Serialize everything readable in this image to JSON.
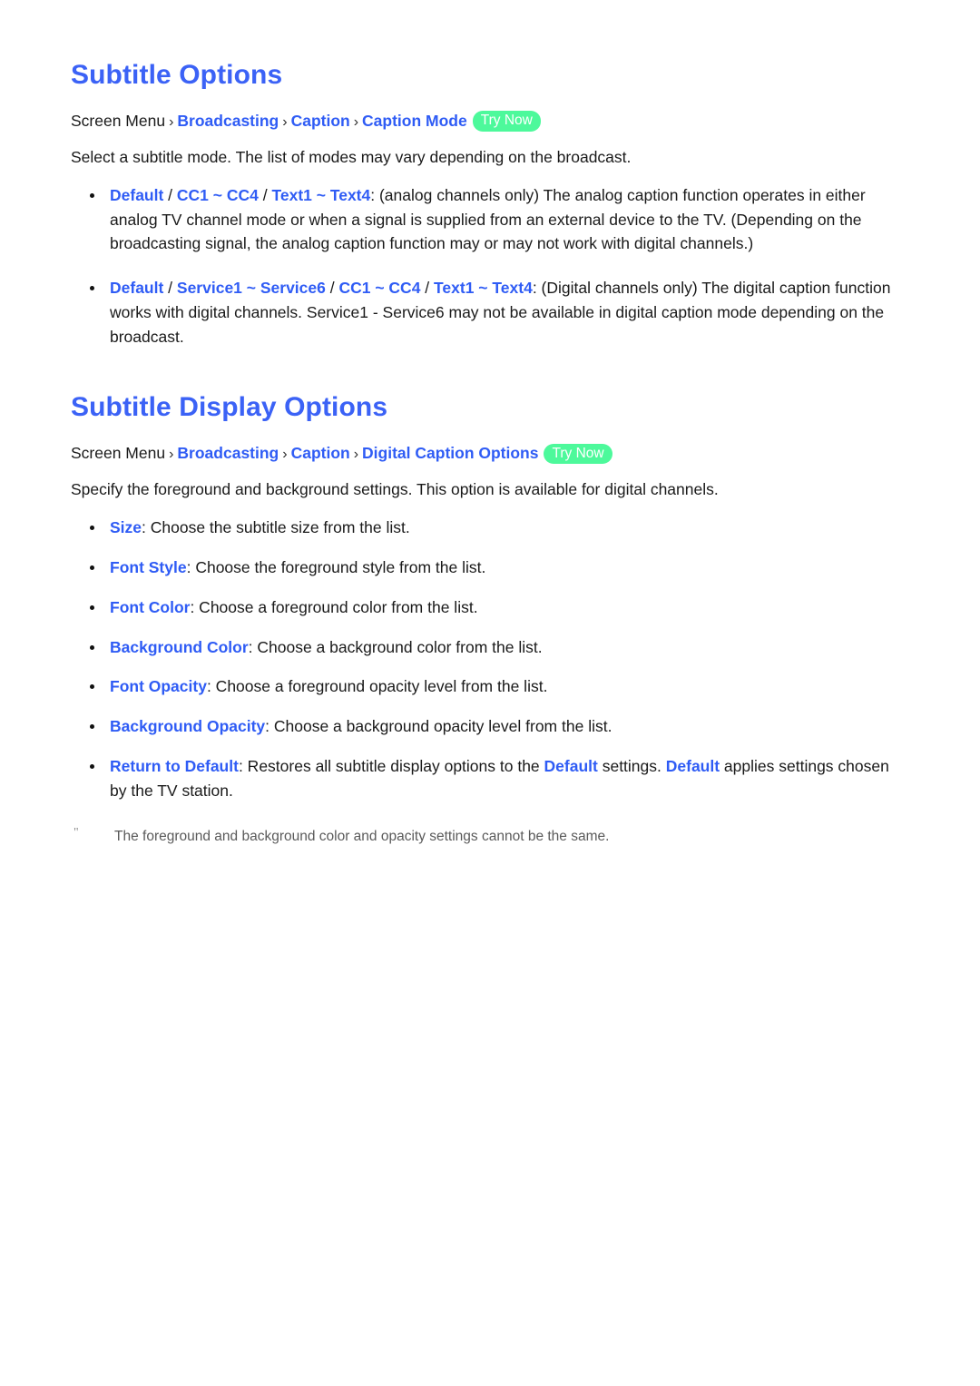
{
  "document": {
    "sections": [
      {
        "title": "Subtitle Options",
        "breadcrumb": {
          "root": "Screen Menu",
          "sep": "›",
          "links": [
            "Broadcasting",
            "Caption",
            "Caption Mode"
          ],
          "badge": "Try Now"
        },
        "intro": "Select a subtitle mode. The list of modes may vary depending on the broadcast.",
        "bullets": [
          {
            "terms": [
              "Default",
              "CC1 ~ CC4",
              "Text1 ~ Text4"
            ],
            "separator": " / ",
            "body": ": (analog channels only) The analog caption function operates in either analog TV channel mode or when a signal is supplied from an external device to the TV. (Depending on the broadcasting signal, the analog caption function may or may not work with digital channels.)"
          },
          {
            "terms": [
              "Default",
              "Service1 ~ Service6",
              "CC1 ~ CC4",
              "Text1 ~ Text4"
            ],
            "separator": " / ",
            "body": ": (Digital channels only) The digital caption function works with digital channels. Service1 - Service6 may not be available in digital caption mode depending on the broadcast."
          }
        ]
      },
      {
        "title": "Subtitle Display Options",
        "breadcrumb": {
          "root": "Screen Menu",
          "sep": "›",
          "links": [
            "Broadcasting",
            "Caption",
            "Digital Caption Options"
          ],
          "badge": "Try Now"
        },
        "intro": "Specify the foreground and background settings. This option is available for digital channels.",
        "bullets": [
          {
            "term": "Size",
            "body": ": Choose the subtitle size from the list."
          },
          {
            "term": "Font Style",
            "body": ": Choose the foreground style from the list."
          },
          {
            "term": "Font Color",
            "body": ": Choose a foreground color from the list."
          },
          {
            "term": "Background Color",
            "body": ": Choose a background color from the list."
          },
          {
            "term": "Font Opacity",
            "body": ": Choose a foreground opacity level from the list."
          },
          {
            "term": "Background Opacity",
            "body": ": Choose a background opacity level from the list."
          }
        ],
        "return_bullet": {
          "term": "Return to Default",
          "body_1": ": Restores all subtitle display options to the ",
          "inline_1": "Default",
          "body_2": " settings. ",
          "inline_2": "Default",
          "body_3": " applies settings chosen by the TV station."
        },
        "note": {
          "mark": "\"",
          "text": "The foreground and background color and opacity settings cannot be the same."
        }
      }
    ]
  },
  "colors": {
    "link_blue": "#2f5cf5",
    "heading_blue": "#3b62f6",
    "badge_green": "#4df99b",
    "body_text": "#1a1a1a",
    "note_text": "#5a5a5a"
  }
}
